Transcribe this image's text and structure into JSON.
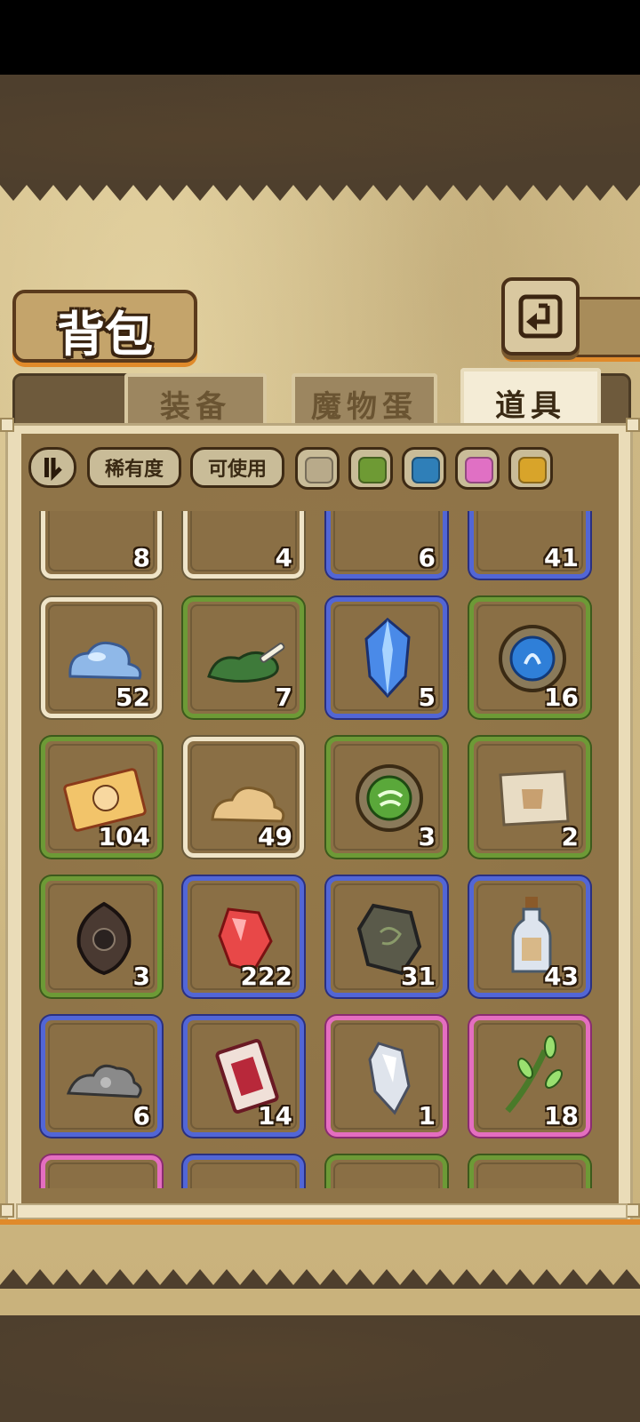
{
  "header": {
    "title": "背包"
  },
  "tabs": [
    {
      "label": "装备",
      "active": false
    },
    {
      "label": "魔物蛋",
      "active": false
    },
    {
      "label": "道具",
      "active": true
    }
  ],
  "filters": {
    "rarity_label": "稀有度",
    "usable_label": "可使用",
    "colors": [
      "#b8aa8a",
      "#6e9a34",
      "#2f7fb8",
      "#e070c4",
      "#d8a42a"
    ]
  },
  "colors": {
    "white": "#efe4c8",
    "green": "#6d9a36",
    "blue": "#5266d6",
    "pink": "#e46ec0"
  },
  "items": [
    {
      "icon": "partial-item-icon",
      "rarity": "white",
      "count": "8"
    },
    {
      "icon": "partial-item-icon",
      "rarity": "white",
      "count": "4"
    },
    {
      "icon": "partial-item-icon",
      "rarity": "blue",
      "count": "6"
    },
    {
      "icon": "partial-item-icon",
      "rarity": "blue",
      "count": "41"
    },
    {
      "icon": "blue-slime-icon",
      "rarity": "white",
      "count": "52"
    },
    {
      "icon": "green-fur-bone-icon",
      "rarity": "green",
      "count": "7"
    },
    {
      "icon": "blue-crystal-icon",
      "rarity": "blue",
      "count": "5"
    },
    {
      "icon": "water-emblem-icon",
      "rarity": "green",
      "count": "16"
    },
    {
      "icon": "pet-ticket-icon",
      "rarity": "green",
      "count": "104"
    },
    {
      "icon": "sand-pile-icon",
      "rarity": "white",
      "count": "49"
    },
    {
      "icon": "wind-emblem-icon",
      "rarity": "green",
      "count": "3"
    },
    {
      "icon": "treasure-map-icon",
      "rarity": "green",
      "count": "2"
    },
    {
      "icon": "dark-amulet-icon",
      "rarity": "green",
      "count": "3"
    },
    {
      "icon": "red-gem-icon",
      "rarity": "blue",
      "count": "222"
    },
    {
      "icon": "stone-tablet-icon",
      "rarity": "blue",
      "count": "31"
    },
    {
      "icon": "message-bottle-icon",
      "rarity": "blue",
      "count": "43"
    },
    {
      "icon": "gray-ore-icon",
      "rarity": "blue",
      "count": "6"
    },
    {
      "icon": "skill-card-icon",
      "rarity": "blue",
      "count": "14"
    },
    {
      "icon": "silver-shard-icon",
      "rarity": "pink",
      "count": "1"
    },
    {
      "icon": "herb-branch-icon",
      "rarity": "pink",
      "count": "18"
    },
    {
      "icon": "burger-icon",
      "rarity": "pink",
      "count": ""
    },
    {
      "icon": "pink-orb-icon",
      "rarity": "blue",
      "count": ""
    },
    {
      "icon": "cat-paper-icon",
      "rarity": "green",
      "count": ""
    },
    {
      "icon": "blue-card-icon",
      "rarity": "green",
      "count": ""
    }
  ]
}
